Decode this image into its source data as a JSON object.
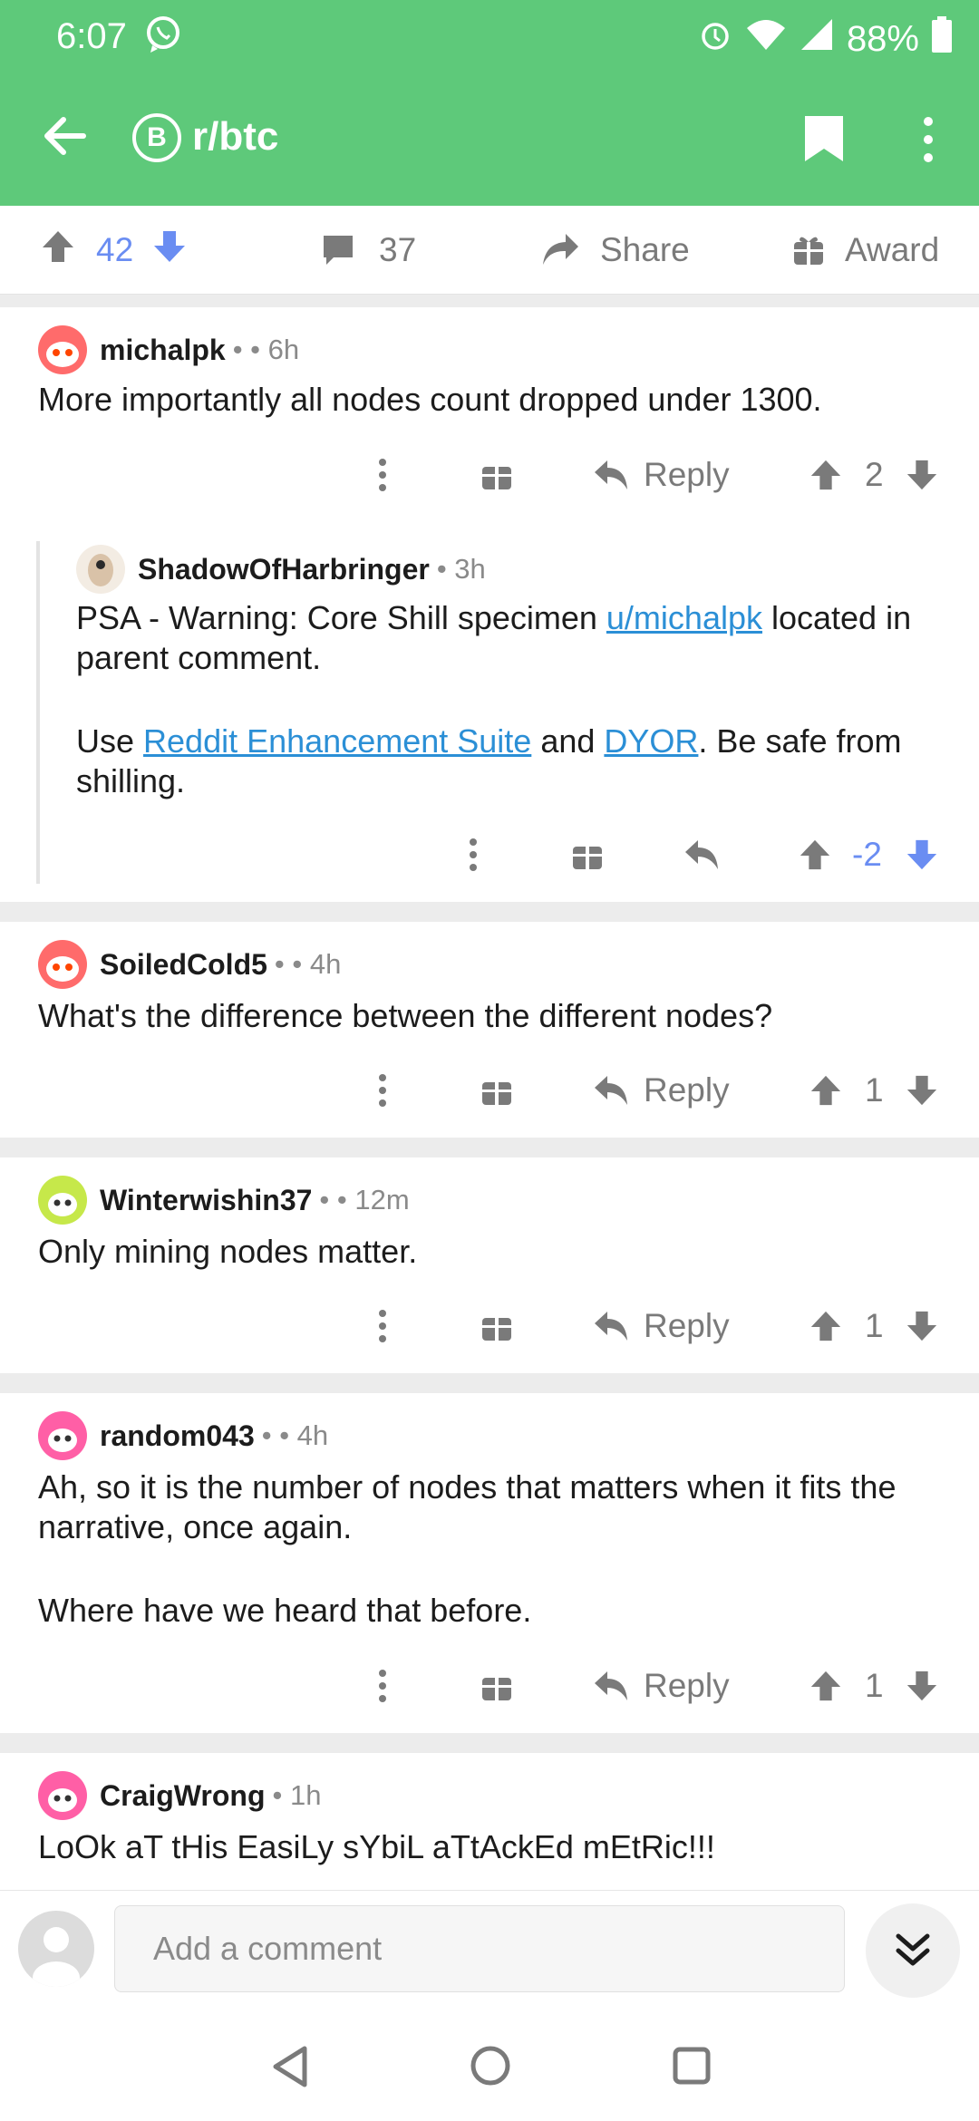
{
  "status": {
    "time": "6:07",
    "battery": "88%"
  },
  "header": {
    "subreddit": "r/btc",
    "sub_icon_glyph": "B",
    "brand_color": "#5ec97a"
  },
  "post_actions": {
    "score": "42",
    "comments": "37",
    "share": "Share",
    "award": "Award"
  },
  "comments": [
    {
      "user": "michalpk",
      "meta": "• • 6h",
      "body": "More importantly all nodes count dropped under 1300.",
      "reply": "Reply",
      "score": "2"
    },
    {
      "user": "ShadowOfHarbringer",
      "meta": "• 3h",
      "body1_pre": "PSA - Warning: Core Shill specimen ",
      "body1_link": "u/michalpk",
      "body1_post": " located in parent comment.",
      "body2_pre": "Use ",
      "body2_link1": "Reddit Enhancement Suite",
      "body2_mid": " and ",
      "body2_link2": "DYOR",
      "body2_post": ". Be safe from shilling.",
      "score": "-2"
    },
    {
      "user": "SoiledCold5",
      "meta": "• • 4h",
      "body": "What's the difference between the different nodes?",
      "reply": "Reply",
      "score": "1"
    },
    {
      "user": "Winterwishin37",
      "meta": "• • 12m",
      "body": "Only mining nodes matter.",
      "reply": "Reply",
      "score": "1"
    },
    {
      "user": "random043",
      "meta": "• • 4h",
      "body1": "Ah, so it is the number of nodes that matters when it fits the narrative, once again.",
      "body2": "Where have we heard that before.",
      "reply": "Reply",
      "score": "1"
    },
    {
      "user": "CraigWrong",
      "meta": "• 1h",
      "body": "LoOk aT tHis EasiLy sYbiL aTtAckEd mEtRic!!!"
    }
  ],
  "composer": {
    "placeholder": "Add a comment"
  },
  "colors": {
    "upvote_active": "#6a8df2",
    "link": "#2b8fd6",
    "icon_gray": "#7a7a7a"
  }
}
